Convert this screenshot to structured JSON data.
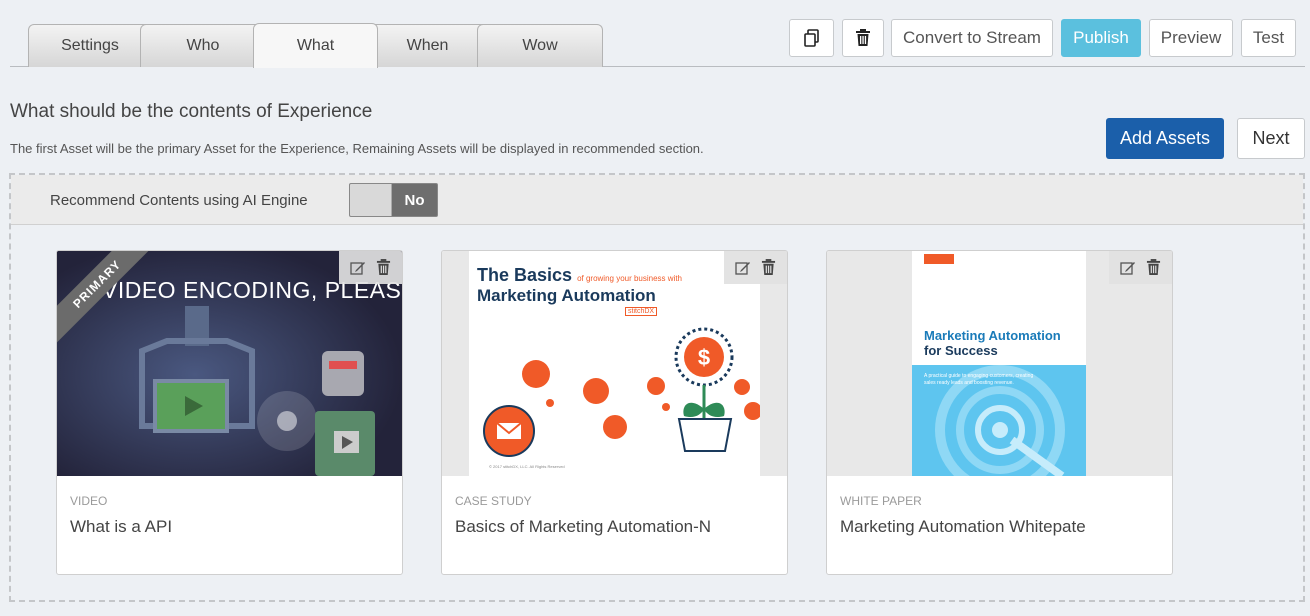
{
  "tabs": [
    {
      "label": "Settings"
    },
    {
      "label": "Who"
    },
    {
      "label": "What"
    },
    {
      "label": "When"
    },
    {
      "label": "Wow"
    }
  ],
  "toolbar": {
    "convert_label": "Convert to Stream",
    "publish_label": "Publish",
    "preview_label": "Preview",
    "test_label": "Test",
    "icons": {
      "copy": "copy-icon",
      "delete": "trash-icon"
    },
    "publish_color": "#5bc0de"
  },
  "page": {
    "heading": "What should be the contents of Experience",
    "subtext": "The first Asset will be the primary Asset for the Experience, Remaining Assets will be displayed in recommended section.",
    "add_assets_label": "Add Assets",
    "next_label": "Next",
    "add_assets_color": "#1b5faa"
  },
  "ai": {
    "label": "Recommend Contents using AI Engine",
    "toggle_value": "No"
  },
  "cards": [
    {
      "type": "VIDEO",
      "title": "What is a API",
      "ribbon": "PRIMARY",
      "thumb_text": "VIDEO ENCODING, PLEASE WAIT"
    },
    {
      "type": "CASE STUDY",
      "title": "Basics of Marketing Automation-N",
      "thumb_line1": "The Basics",
      "thumb_line1_small": "of growing your business with",
      "thumb_line2": "Marketing Automation",
      "thumb_brand": "stitchDX"
    },
    {
      "type": "WHITE PAPER",
      "title": "Marketing Automation Whitepate",
      "thumb_line1": "Marketing Automation",
      "thumb_line2": "for Success",
      "thumb_small": "A practical guide to engaging customers, creating sales ready leads and boosting revenue."
    }
  ]
}
